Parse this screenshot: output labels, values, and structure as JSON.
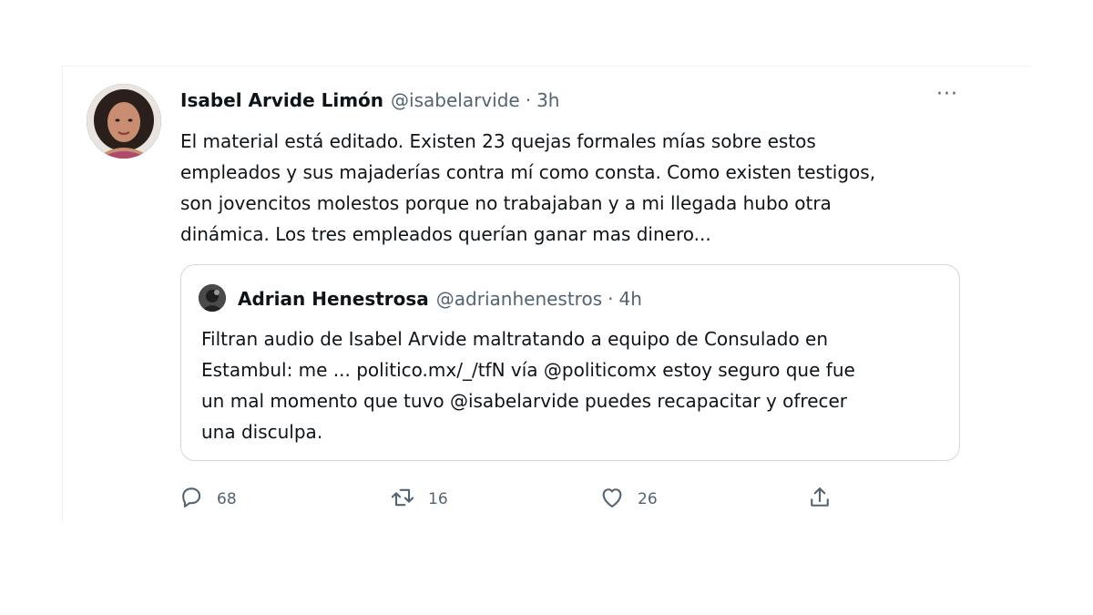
{
  "tweet": {
    "author_name": "Isabel Arvide Limón",
    "author_handle": "@isabelarvide",
    "separator": "·",
    "time": "3h",
    "more_label": "···",
    "text": "El material está editado. Existen 23 quejas formales mías sobre estos\nempleados y sus majaderías contra mí como consta. Como existen testigos,\nson jovencitos molestos porque no trabajaban y a mi llegada hubo otra\ndinámica. Los tres empleados querían ganar mas dinero..."
  },
  "quoted": {
    "author_name": "Adrian Henestrosa",
    "author_handle": "@adrianhenestros",
    "separator": "·",
    "time": "4h",
    "text": "Filtran audio de Isabel Arvide maltratando a equipo de Consulado en\nEstambul: me ... politico.mx/_/tfN vía @politicomx estoy seguro que fue\nun mal momento que tuvo @isabelarvide puedes recapacitar y ofrecer\nuna disculpa."
  },
  "actions": {
    "reply_count": "68",
    "retweet_count": "16",
    "like_count": "26"
  },
  "icons": {
    "reply": "reply-icon",
    "retweet": "retweet-icon",
    "like": "heart-icon",
    "share": "share-icon",
    "more": "more-icon"
  },
  "colors": {
    "text": "#0f1419",
    "secondary": "#536471",
    "border": "#cfd9de"
  }
}
